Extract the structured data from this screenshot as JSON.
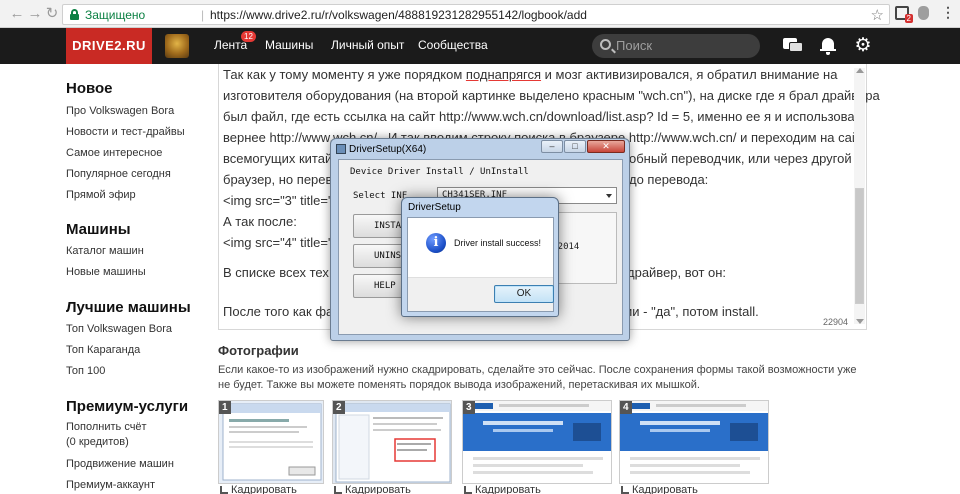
{
  "browser": {
    "secure_label": "Защищено",
    "url_separator": "|",
    "url": "https://www.drive2.ru/r/volkswagen/488819231282955142/logbook/add",
    "ext_badge": "2"
  },
  "header": {
    "logo": "DRIVE2.RU",
    "nav": [
      {
        "label": "Лента",
        "badge": "12"
      },
      {
        "label": "Машины"
      },
      {
        "label": "Личный опыт"
      },
      {
        "label": "Сообщества"
      }
    ],
    "search_placeholder": "Поиск"
  },
  "sidebar": {
    "sections": [
      {
        "title": "Новое",
        "items": [
          "Про Volkswagen Bora",
          "Новости и тест-драйвы",
          "Самое интересное",
          "Популярное сегодня",
          "Прямой эфир"
        ]
      },
      {
        "title": "Машины",
        "items": [
          "Каталог машин",
          "Новые машины"
        ]
      },
      {
        "title": "Лучшие машины",
        "items": [
          "Топ Volkswagen Bora",
          "Топ Караганда",
          "Топ 100"
        ]
      },
      {
        "title": "Премиум-услуги",
        "items": [
          "Пополнить счёт",
          "(0 кредитов)",
          "Продвижение машин",
          "Премиум-аккаунт"
        ]
      }
    ]
  },
  "editor": {
    "lines": [
      "Так как у тому моменту я уже порядком",
      "поднапрягся",
      "и мозг активизировался, я обратил внимание на",
      "изготовителя оборудования (на второй картинке выделено красным \"wch.cn\"), на диске где я брал драйвера",
      "был файл, где есть ссылка на сайт http://www.wch.cn/download/list.asp? Id = 5, именно ее я и использовал,",
      "вернее http://www.wch.cn/ . И так вводим строку поиска в браузере http://www.wch.cn/ и переходим на сайт",
      "всемогущих китай",
      "обный переводчик, или через другой",
      "браузер, но перево",
      "до перевода:",
      "<img src=\"3\" title=\"Д",
      "А так после:",
      "<img src=\"4\" title=\"П",
      "В списке всех тех.",
      "драйвер, вот он:",
      "После того как фай",
      "лении - \"да\", потом install."
    ],
    "char_count": "22904"
  },
  "photos": {
    "title": "Фотографии",
    "description": "Если какое-то из изображений нужно скадрировать, сделайте это сейчас. После сохранения формы такой возможности уже не будет. Также вы можете поменять порядок вывода изображений, перетаскивая их мышкой.",
    "thumbs": [
      {
        "num": "1",
        "crop": "Кадрировать"
      },
      {
        "num": "2",
        "crop": "Кадрировать"
      },
      {
        "num": "3",
        "crop": "Кадрировать"
      },
      {
        "num": "4",
        "crop": "Кадрировать"
      }
    ]
  },
  "driver_setup": {
    "title": "DriverSetup(X64)",
    "group_label": "Device Driver Install / UnInstall",
    "select_label": "Select INF",
    "select_value": "CH341SER.INF",
    "buttons": [
      "INSTALL",
      "UNINSTALL",
      "HELP"
    ],
    "info_text": "3.4.2014"
  },
  "message_box": {
    "title": "DriverSetup",
    "text": "Driver install success!",
    "ok_label": "OK"
  }
}
